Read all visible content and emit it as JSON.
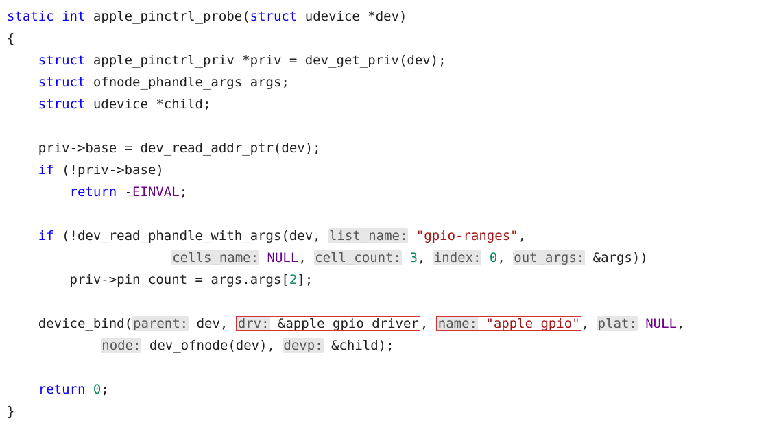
{
  "func": {
    "signature_static": "static",
    "signature_int": "int",
    "name": "apple_pinctrl_probe",
    "param_decl": "struct udevice *dev"
  },
  "decls": {
    "l1_struct": "struct",
    "l1_type": "apple_pinctrl_priv",
    "l1_rest": " *priv = dev_get_priv(dev);",
    "l2_struct": "struct",
    "l2_rest": " ofnode_phandle_args args;",
    "l3_struct": "struct",
    "l3_rest": " udevice *child;"
  },
  "body": {
    "b1": "priv->base = dev_read_addr_ptr(dev);",
    "if1_kw": "if",
    "if1_cond": " (!priv->base)",
    "ret1_kw": "return",
    "ret1_rest": " -",
    "ret1_const": "EINVAL",
    "ret1_semi": ";",
    "if2_kw": "if",
    "if2_open": " (!dev_read_phandle_with_args(dev, ",
    "hint_list_name": "list_name:",
    "arg_list_name": " \"gpio-ranges\"",
    "if2_cont1": ",",
    "hint_cells_name": "cells_name:",
    "arg_cells_name_sp": " ",
    "arg_cells_name": "NULL",
    "sep1": ", ",
    "hint_cell_count": "cell_count:",
    "arg_cell_count_sp": " ",
    "arg_cell_count": "3",
    "sep2": ", ",
    "hint_index": "index:",
    "arg_index_sp": " ",
    "arg_index": "0",
    "sep3": ", ",
    "hint_out_args": "out_args:",
    "arg_out_args": " &args))",
    "pin_line_a": "priv->pin_count = args.args[",
    "pin_idx": "2",
    "pin_line_b": "];",
    "db_open": "device_bind(",
    "hint_parent": "parent:",
    "arg_parent": " dev, ",
    "hint_drv": "drv:",
    "arg_drv": " &apple_gpio_driver",
    "db_sep1": ", ",
    "hint_name": "name:",
    "arg_name": " \"apple_gpio\"",
    "db_sep2": ", ",
    "hint_plat": "plat:",
    "arg_plat_sp": " ",
    "arg_plat": "NULL",
    "db_sep3": ",",
    "hint_node": "node:",
    "arg_node": " dev_ofnode(dev), ",
    "hint_devp": "devp:",
    "arg_devp": " &child);",
    "ret2_kw": "return",
    "ret2_sp": " ",
    "ret2_val": "0",
    "ret2_semi": ";"
  },
  "braces": {
    "open": "{",
    "close": "}"
  }
}
